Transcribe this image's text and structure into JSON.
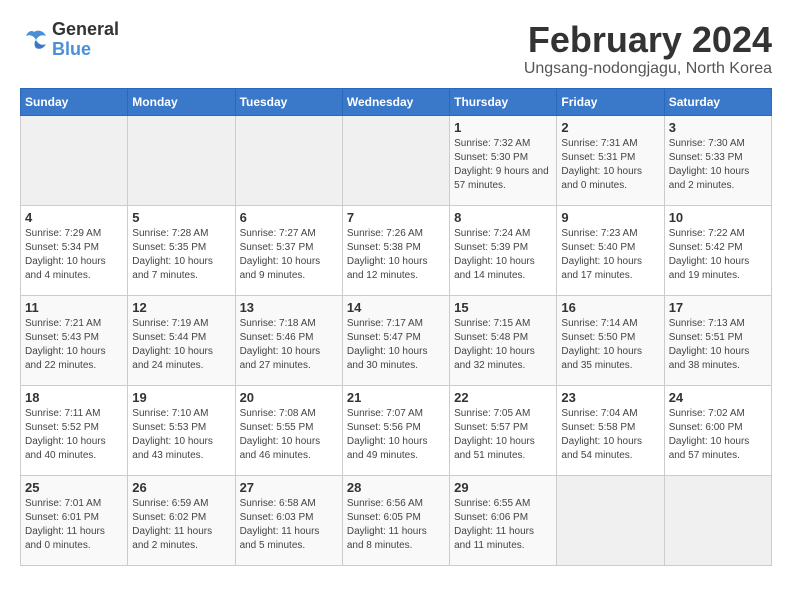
{
  "logo": {
    "line1": "General",
    "line2": "Blue"
  },
  "title": "February 2024",
  "subtitle": "Ungsang-nodongjagu, North Korea",
  "days_header": [
    "Sunday",
    "Monday",
    "Tuesday",
    "Wednesday",
    "Thursday",
    "Friday",
    "Saturday"
  ],
  "weeks": [
    [
      {
        "day": "",
        "info": ""
      },
      {
        "day": "",
        "info": ""
      },
      {
        "day": "",
        "info": ""
      },
      {
        "day": "",
        "info": ""
      },
      {
        "day": "1",
        "info": "Sunrise: 7:32 AM\nSunset: 5:30 PM\nDaylight: 9 hours and 57 minutes."
      },
      {
        "day": "2",
        "info": "Sunrise: 7:31 AM\nSunset: 5:31 PM\nDaylight: 10 hours and 0 minutes."
      },
      {
        "day": "3",
        "info": "Sunrise: 7:30 AM\nSunset: 5:33 PM\nDaylight: 10 hours and 2 minutes."
      }
    ],
    [
      {
        "day": "4",
        "info": "Sunrise: 7:29 AM\nSunset: 5:34 PM\nDaylight: 10 hours and 4 minutes."
      },
      {
        "day": "5",
        "info": "Sunrise: 7:28 AM\nSunset: 5:35 PM\nDaylight: 10 hours and 7 minutes."
      },
      {
        "day": "6",
        "info": "Sunrise: 7:27 AM\nSunset: 5:37 PM\nDaylight: 10 hours and 9 minutes."
      },
      {
        "day": "7",
        "info": "Sunrise: 7:26 AM\nSunset: 5:38 PM\nDaylight: 10 hours and 12 minutes."
      },
      {
        "day": "8",
        "info": "Sunrise: 7:24 AM\nSunset: 5:39 PM\nDaylight: 10 hours and 14 minutes."
      },
      {
        "day": "9",
        "info": "Sunrise: 7:23 AM\nSunset: 5:40 PM\nDaylight: 10 hours and 17 minutes."
      },
      {
        "day": "10",
        "info": "Sunrise: 7:22 AM\nSunset: 5:42 PM\nDaylight: 10 hours and 19 minutes."
      }
    ],
    [
      {
        "day": "11",
        "info": "Sunrise: 7:21 AM\nSunset: 5:43 PM\nDaylight: 10 hours and 22 minutes."
      },
      {
        "day": "12",
        "info": "Sunrise: 7:19 AM\nSunset: 5:44 PM\nDaylight: 10 hours and 24 minutes."
      },
      {
        "day": "13",
        "info": "Sunrise: 7:18 AM\nSunset: 5:46 PM\nDaylight: 10 hours and 27 minutes."
      },
      {
        "day": "14",
        "info": "Sunrise: 7:17 AM\nSunset: 5:47 PM\nDaylight: 10 hours and 30 minutes."
      },
      {
        "day": "15",
        "info": "Sunrise: 7:15 AM\nSunset: 5:48 PM\nDaylight: 10 hours and 32 minutes."
      },
      {
        "day": "16",
        "info": "Sunrise: 7:14 AM\nSunset: 5:50 PM\nDaylight: 10 hours and 35 minutes."
      },
      {
        "day": "17",
        "info": "Sunrise: 7:13 AM\nSunset: 5:51 PM\nDaylight: 10 hours and 38 minutes."
      }
    ],
    [
      {
        "day": "18",
        "info": "Sunrise: 7:11 AM\nSunset: 5:52 PM\nDaylight: 10 hours and 40 minutes."
      },
      {
        "day": "19",
        "info": "Sunrise: 7:10 AM\nSunset: 5:53 PM\nDaylight: 10 hours and 43 minutes."
      },
      {
        "day": "20",
        "info": "Sunrise: 7:08 AM\nSunset: 5:55 PM\nDaylight: 10 hours and 46 minutes."
      },
      {
        "day": "21",
        "info": "Sunrise: 7:07 AM\nSunset: 5:56 PM\nDaylight: 10 hours and 49 minutes."
      },
      {
        "day": "22",
        "info": "Sunrise: 7:05 AM\nSunset: 5:57 PM\nDaylight: 10 hours and 51 minutes."
      },
      {
        "day": "23",
        "info": "Sunrise: 7:04 AM\nSunset: 5:58 PM\nDaylight: 10 hours and 54 minutes."
      },
      {
        "day": "24",
        "info": "Sunrise: 7:02 AM\nSunset: 6:00 PM\nDaylight: 10 hours and 57 minutes."
      }
    ],
    [
      {
        "day": "25",
        "info": "Sunrise: 7:01 AM\nSunset: 6:01 PM\nDaylight: 11 hours and 0 minutes."
      },
      {
        "day": "26",
        "info": "Sunrise: 6:59 AM\nSunset: 6:02 PM\nDaylight: 11 hours and 2 minutes."
      },
      {
        "day": "27",
        "info": "Sunrise: 6:58 AM\nSunset: 6:03 PM\nDaylight: 11 hours and 5 minutes."
      },
      {
        "day": "28",
        "info": "Sunrise: 6:56 AM\nSunset: 6:05 PM\nDaylight: 11 hours and 8 minutes."
      },
      {
        "day": "29",
        "info": "Sunrise: 6:55 AM\nSunset: 6:06 PM\nDaylight: 11 hours and 11 minutes."
      },
      {
        "day": "",
        "info": ""
      },
      {
        "day": "",
        "info": ""
      }
    ]
  ]
}
